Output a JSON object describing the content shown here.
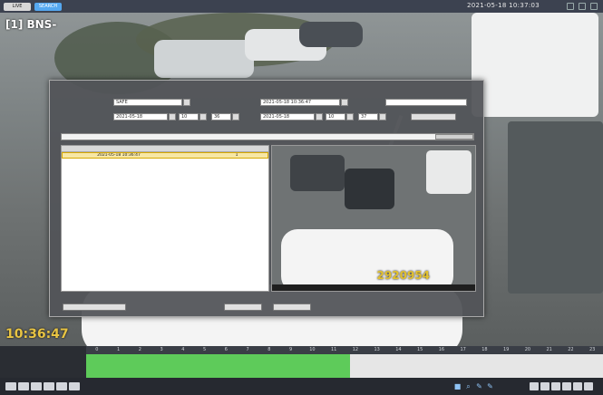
{
  "app": {
    "top_tabs": [
      "LIVE",
      "SEARCH"
    ],
    "clock": "2021-05-18 10:37:03"
  },
  "camera": {
    "title": "[1] BNS-",
    "time_overlay": "10:36:47"
  },
  "dialog": {
    "title": "",
    "row1": {
      "label1": "",
      "value1": "SAFE",
      "label2": "",
      "value2": "2021-05-18 10:36:47",
      "label3": "",
      "value3": ""
    },
    "row2": {
      "label": "",
      "start_date": "2021-05-18",
      "start_h": "10",
      "start_m": "36",
      "end_date": "2021-05-18",
      "end_h": "10",
      "end_m": "37",
      "search_btn": ""
    },
    "path": "",
    "list": {
      "headers": [
        "",
        "",
        "",
        ""
      ],
      "rows": [
        [
          "",
          "2021-05-18 10:36:47",
          "",
          "1"
        ]
      ]
    },
    "preview": {
      "watermark": "2920954",
      "status": ""
    },
    "buttons": {
      "left": "",
      "mid": "",
      "right": ""
    }
  },
  "timeline": {
    "hours": [
      "0",
      "1",
      "2",
      "3",
      "4",
      "5",
      "6",
      "7",
      "8",
      "9",
      "10",
      "11",
      "12",
      "13",
      "14",
      "15",
      "16",
      "17",
      "18",
      "19",
      "20",
      "21",
      "22",
      "23"
    ],
    "track_label": "",
    "coverage_fraction": 0.51
  }
}
